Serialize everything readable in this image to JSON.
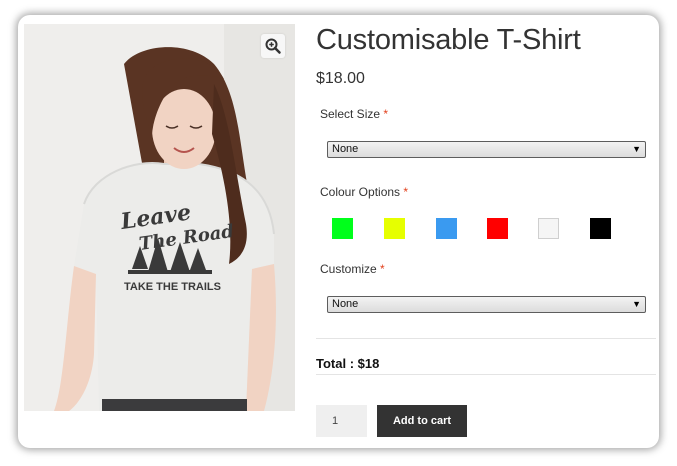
{
  "product": {
    "title": "Customisable T-Shirt",
    "price": "$18.00",
    "image": {
      "print_lines": [
        "Leave",
        "The Road",
        "TAKE THE TRAILS"
      ],
      "colors": {
        "shirt": "#ececea",
        "hair": "#5a3423",
        "skin": "#f1d3c3",
        "print": "#3a3a3a",
        "pants": "#3b3b3d"
      }
    }
  },
  "icons": {
    "zoom": "magnifier-plus-icon"
  },
  "form": {
    "size": {
      "label": "Select Size",
      "required_mark": "*",
      "selected": "None"
    },
    "colour": {
      "label": "Colour Options",
      "required_mark": "*",
      "swatches": [
        {
          "name": "green",
          "hex": "#00ff1b"
        },
        {
          "name": "yellow",
          "hex": "#e6ff00"
        },
        {
          "name": "blue",
          "hex": "#3a9af0"
        },
        {
          "name": "red",
          "hex": "#ff0000"
        },
        {
          "name": "white",
          "hex": "#f5f5f5"
        },
        {
          "name": "black",
          "hex": "#000000"
        }
      ]
    },
    "customize": {
      "label": "Customize",
      "required_mark": "*",
      "selected": "None"
    }
  },
  "total": {
    "label": "Total :",
    "value": "$18"
  },
  "cart": {
    "quantity": "1",
    "add_label": "Add to cart"
  },
  "colors": {
    "required": "#e2401c",
    "button_bg": "#333333",
    "quantity_bg": "#efefef"
  }
}
